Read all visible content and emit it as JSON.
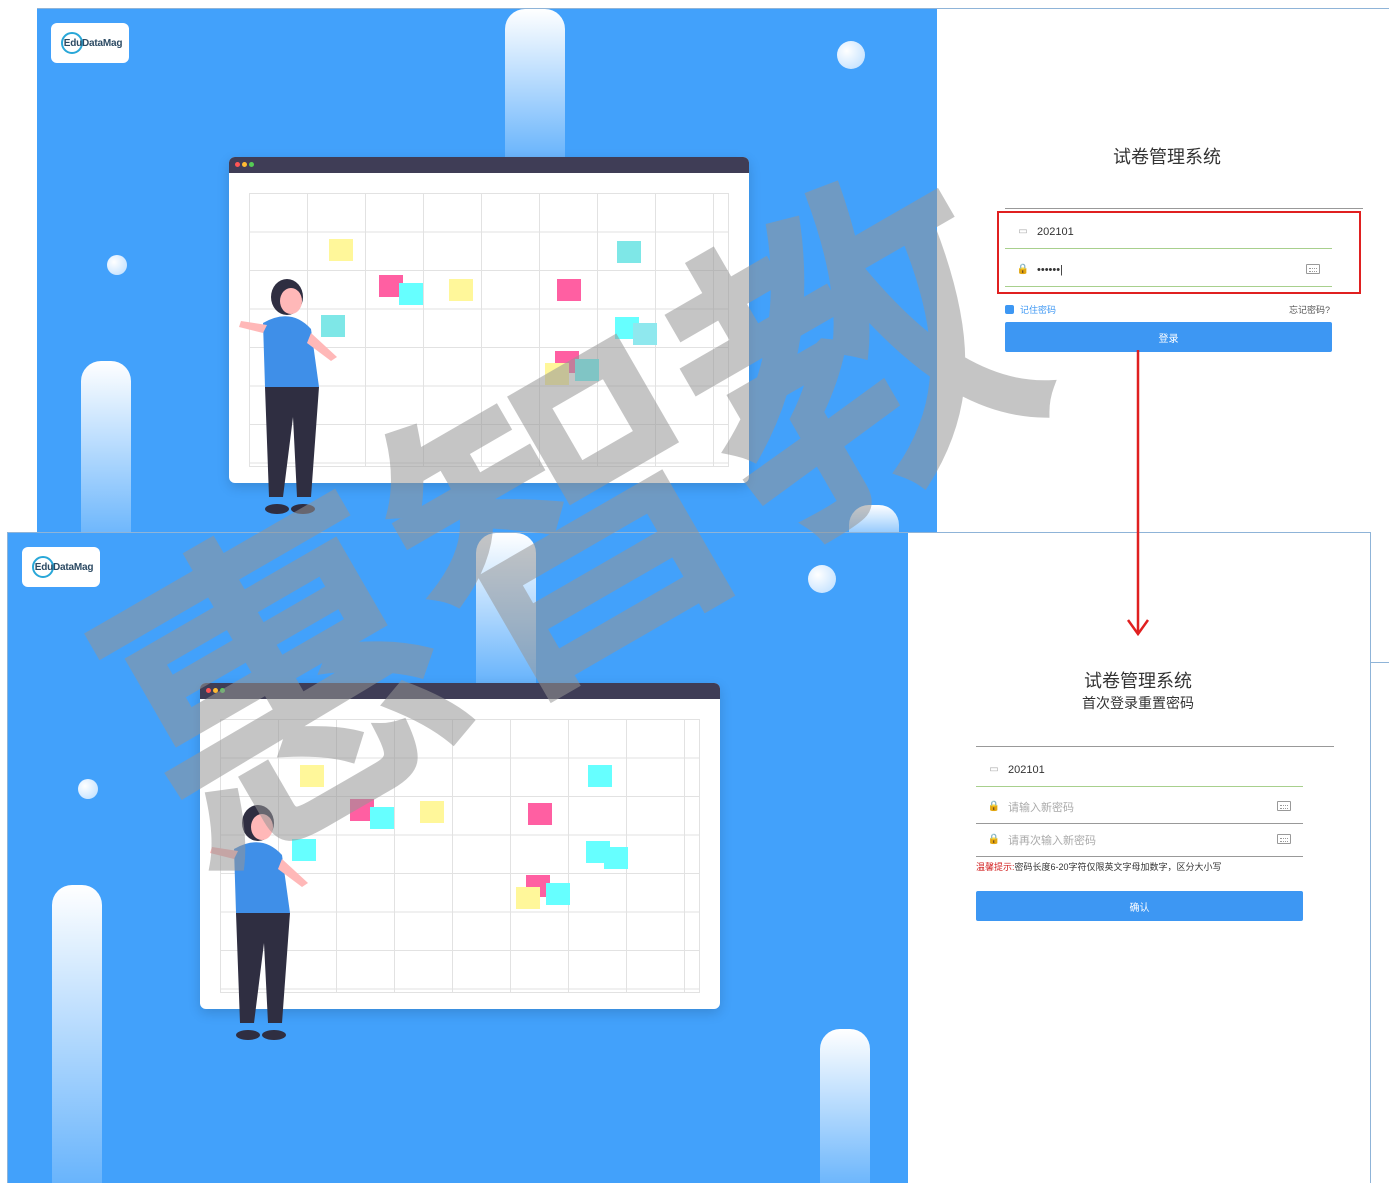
{
  "logo": {
    "text": "EduDataMag"
  },
  "login": {
    "title": "试卷管理系统",
    "username_value": "202101",
    "password_value": "••••••|",
    "remember_label": "记住密码",
    "forgot_label": "忘记密码?",
    "submit_label": "登录"
  },
  "reset": {
    "title": "试卷管理系统",
    "subtitle": "首次登录重置密码",
    "username_value": "202101",
    "new_password_placeholder": "请输入新密码",
    "confirm_password_placeholder": "请再次输入新密码",
    "hint_label": "温馨提示:",
    "hint_text": "密码长度6-20字符仅限英文字母加数字，区分大小写",
    "submit_label": "确认"
  },
  "watermark": {
    "text": "惠智教"
  },
  "colors": {
    "hero": "#42a1fb",
    "button": "#3d97f3",
    "highlight": "#e02020",
    "field_underline": "#a8d08d"
  }
}
